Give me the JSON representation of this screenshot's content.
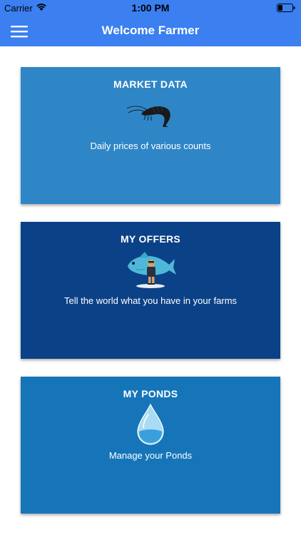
{
  "status_bar": {
    "carrier": "Carrier",
    "time": "1:00 PM"
  },
  "header": {
    "title": "Welcome Farmer",
    "menu_icon": "hamburger-menu-icon"
  },
  "cards": [
    {
      "title": "MARKET DATA",
      "description": "Daily prices of various counts",
      "icon": "shrimp-icon",
      "color": "#2f86c6"
    },
    {
      "title": "MY OFFERS",
      "description": "Tell the world what you have in your farms",
      "icon": "fisherman-with-fish-icon",
      "color": "#0b4187"
    },
    {
      "title": "MY PONDS",
      "description": "Manage your Ponds",
      "icon": "water-drop-icon",
      "color": "#1575b8"
    }
  ],
  "colors": {
    "accent": "#3b7ff0"
  }
}
